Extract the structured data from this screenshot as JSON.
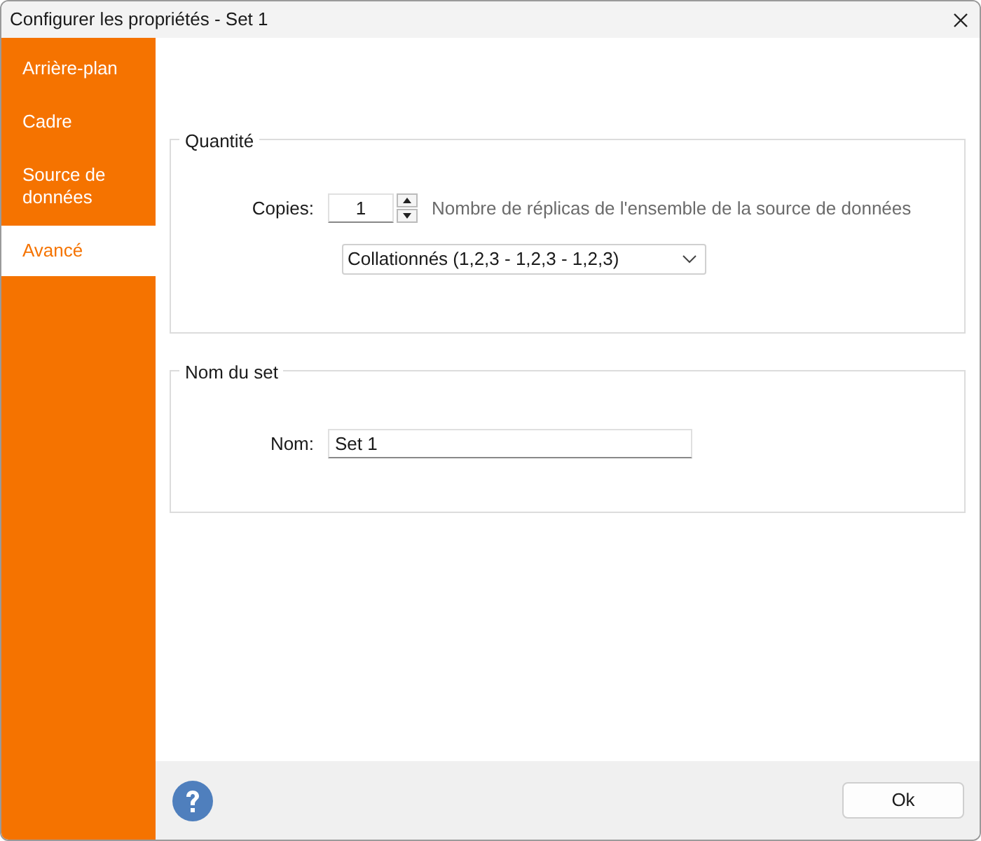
{
  "window": {
    "title": "Configurer les propriétés - Set 1"
  },
  "sidebar": {
    "items": [
      {
        "label": "Arrière-plan",
        "selected": false
      },
      {
        "label": "Cadre",
        "selected": false
      },
      {
        "label": "Source de données",
        "selected": false
      },
      {
        "label": "Avancé",
        "selected": true
      }
    ]
  },
  "quantity_group": {
    "title": "Quantité",
    "copies_label": "Copies:",
    "copies_value": "1",
    "copies_hint": "Nombre de réplicas de l'ensemble de la source de données",
    "order_dropdown": "Collationnés (1,2,3 - 1,2,3 - 1,2,3)"
  },
  "name_group": {
    "title": "Nom du set",
    "name_label": "Nom:",
    "name_value": "Set 1"
  },
  "buttons": [
    "Ok"
  ]
}
